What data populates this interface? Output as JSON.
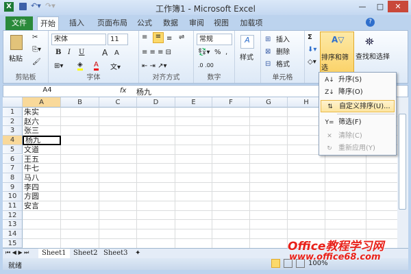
{
  "window": {
    "title": "工作簿1 - Microsoft Excel"
  },
  "tabs": [
    "文件",
    "开始",
    "插入",
    "页面布局",
    "公式",
    "数据",
    "审阅",
    "视图",
    "加载项"
  ],
  "ribbon": {
    "clipboard": {
      "paste": "粘贴",
      "label": "剪贴板"
    },
    "font": {
      "name": "宋体",
      "size": "11",
      "bold": "B",
      "italic": "I",
      "underline": "U",
      "grow": "A",
      "shrink": "A",
      "color": "A",
      "label": "字体"
    },
    "alignment": {
      "label": "对齐方式"
    },
    "number": {
      "format": "常规",
      "percent": "%",
      "comma": ",",
      "label": "数字"
    },
    "styles": {
      "label": "样式"
    },
    "cells": {
      "insert": "插入",
      "delete": "删除",
      "format": "格式",
      "label": "单元格"
    },
    "editing": {
      "sort_filter": "排序和筛选",
      "find_select": "查找和选择",
      "sigma": "Σ"
    }
  },
  "formula_bar": {
    "name_box": "A4",
    "fx": "fx",
    "value": "杨九"
  },
  "columns": [
    "A",
    "B",
    "C",
    "D",
    "E",
    "F",
    "G",
    "H",
    "I"
  ],
  "rows": [
    "1",
    "2",
    "3",
    "4",
    "5",
    "6",
    "7",
    "8",
    "9",
    "10",
    "11",
    "12",
    "13",
    "14",
    "15"
  ],
  "column_a": [
    "朱实",
    "赵六",
    "张三",
    "杨九",
    "文道",
    "王五",
    "牛七",
    "马八",
    "李四",
    "方圆",
    "安言"
  ],
  "active_cell": "A4",
  "sort_menu": [
    {
      "label": "升序(S)",
      "icon": "sort-ascending-icon",
      "enabled": true
    },
    {
      "label": "降序(O)",
      "icon": "sort-descending-icon",
      "enabled": true
    },
    {
      "label": "自定义排序(U)...",
      "icon": "custom-sort-icon",
      "enabled": true,
      "highlighted": true
    },
    {
      "label": "筛选(F)",
      "icon": "filter-icon",
      "enabled": true
    },
    {
      "label": "清除(C)",
      "icon": "clear-filter-icon",
      "enabled": false
    },
    {
      "label": "重新应用(Y)",
      "icon": "reapply-icon",
      "enabled": false
    }
  ],
  "sheets": [
    "Sheet1",
    "Sheet2",
    "Sheet3"
  ],
  "status": {
    "text": "就绪",
    "zoom": "100%"
  },
  "watermark": {
    "line1": "Office教程学习网",
    "line2": "www.office68.com"
  },
  "colors": {
    "file_tab": "#2a8a3a",
    "highlight": "#fbd96b",
    "accent": "#e8211a"
  }
}
